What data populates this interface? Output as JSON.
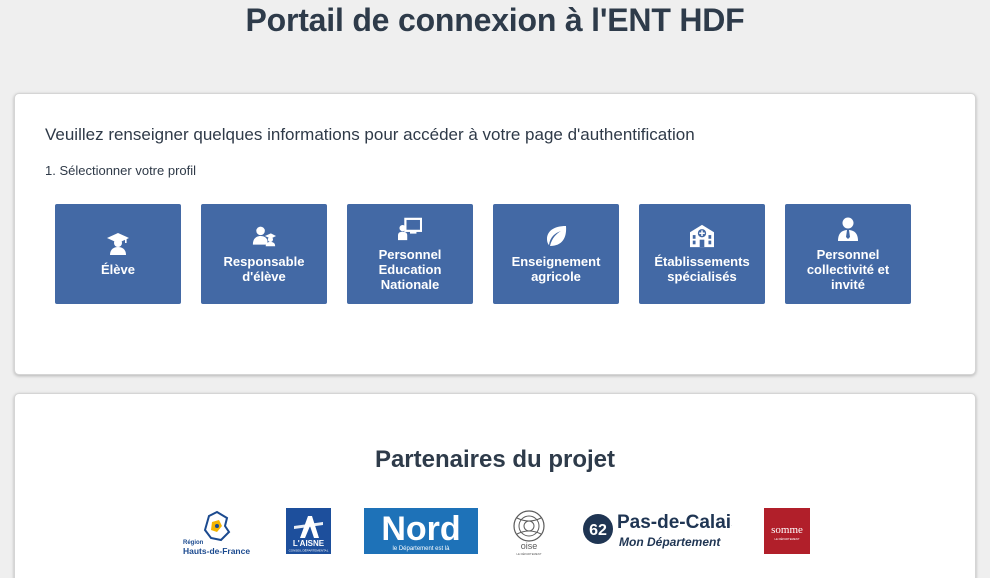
{
  "page": {
    "title": "Portail de connexion à l'ENT HDF"
  },
  "profile_section": {
    "intro": "Veuillez renseigner quelques informations pour accéder à votre page d'authentification",
    "step": "1. Sélectionner votre profil",
    "profiles": [
      {
        "label": "Élève",
        "icon": "graduate-icon"
      },
      {
        "label": "Responsable d'élève",
        "icon": "parent-child-icon"
      },
      {
        "label": "Personnel Education Nationale",
        "icon": "teacher-board-icon"
      },
      {
        "label": "Enseignement agricole",
        "icon": "leaf-icon"
      },
      {
        "label": "Établissements spécialisés",
        "icon": "hospital-building-icon"
      },
      {
        "label": "Personnel collectivité et invité",
        "icon": "person-tie-icon"
      }
    ]
  },
  "partners": {
    "title": "Partenaires du projet",
    "logos": [
      {
        "name": "region-hauts-de-france-logo",
        "text_small": "Région",
        "text_main": "Hauts-de-France"
      },
      {
        "name": "aisne-logo",
        "text_main": "L'AISNE",
        "text_small": "CONSEIL DÉPARTEMENTAL"
      },
      {
        "name": "nord-logo",
        "text_main": "Nord",
        "text_small": "le Département est là"
      },
      {
        "name": "oise-logo",
        "text_main": "oise",
        "text_small": "LE DÉPARTEMENT"
      },
      {
        "name": "pas-de-calais-logo",
        "number": "62",
        "text_main": "Pas-de-Calais",
        "text_small": "Mon Département"
      },
      {
        "name": "somme-logo",
        "text_main": "somme",
        "text_small": "LE DÉPARTEMENT"
      }
    ]
  },
  "colors": {
    "page_bg": "#efefef",
    "button_bg": "#4369a5",
    "title_text": "#2e3b4a",
    "nord_blue": "#1e72b8",
    "aisne_blue": "#1d4f9c",
    "somme_red": "#b11f2a",
    "pdc_navy": "#1f3553"
  }
}
